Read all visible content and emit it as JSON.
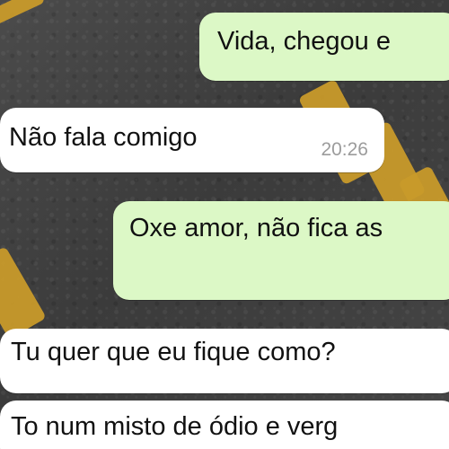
{
  "messages": [
    {
      "text": "Vida, chegou e"
    },
    {
      "text": "Não fala comigo",
      "time": "20:26"
    },
    {
      "text": "Oxe amor, não fica as"
    },
    {
      "text": "Tu quer que eu fique como?"
    },
    {
      "text": "To num misto de ódio e verg"
    }
  ],
  "colors": {
    "outgoing_bubble": "#dcf8c6",
    "incoming_bubble": "#ffffff",
    "timestamp": "#9c9c9c"
  }
}
